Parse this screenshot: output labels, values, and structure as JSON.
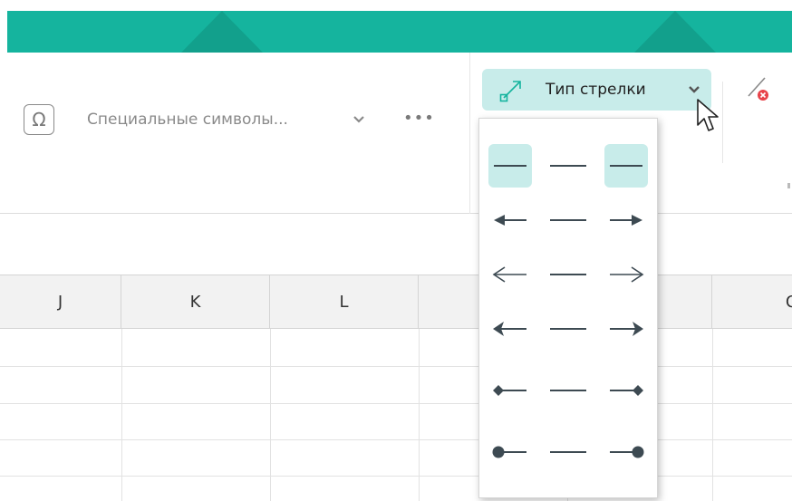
{
  "ribbon": {
    "special_symbols_label": "Специальные символы...",
    "more_label": "•••",
    "omega_glyph": "Ω",
    "arrow_type_label": "Тип стрелки"
  },
  "columns": [
    "J",
    "K",
    "L",
    "",
    "",
    "O"
  ],
  "dropdown": {
    "rows": [
      {
        "start": "none",
        "end": "none",
        "start_selected": true,
        "end_selected": true
      },
      {
        "start": "arrow-filled",
        "end": "arrow-filled",
        "start_selected": false,
        "end_selected": false
      },
      {
        "start": "arrow-open",
        "end": "arrow-open",
        "start_selected": false,
        "end_selected": false
      },
      {
        "start": "arrow-stealth",
        "end": "arrow-stealth",
        "start_selected": false,
        "end_selected": false
      },
      {
        "start": "diamond",
        "end": "diamond",
        "start_selected": false,
        "end_selected": false
      },
      {
        "start": "oval",
        "end": "oval",
        "start_selected": false,
        "end_selected": false
      }
    ]
  },
  "colors": {
    "brand": "#15b49e",
    "selected": "#c8ecea",
    "icon": "#3d4a52"
  }
}
